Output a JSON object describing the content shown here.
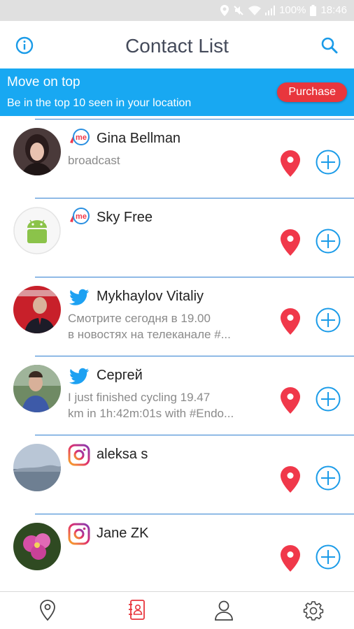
{
  "status_bar": {
    "battery": "100%",
    "time": "18:46"
  },
  "header": {
    "title": "Contact List"
  },
  "promo": {
    "title": "Move on top",
    "subtitle": "Be in the top 10 seen in your location",
    "button_label": "Purchase"
  },
  "contacts": [
    {
      "name": "Gina Bellman",
      "status": "broadcast",
      "source": "me-icon"
    },
    {
      "name": "Sky Free",
      "status": "",
      "source": "me-icon"
    },
    {
      "name": "Mykhaylov Vitaliy",
      "status": "Смотрите сегодня в 19.00\nв новостях на телеканале #...",
      "source": "twitter-icon"
    },
    {
      "name": "Сергей",
      "status": "I just finished cycling 19.47\nkm in 1h:42m:01s with #Endo...",
      "source": "twitter-icon"
    },
    {
      "name": "aleksa s",
      "status": "",
      "source": "instagram-icon"
    },
    {
      "name": "Jane ZK",
      "status": "",
      "source": "instagram-icon"
    }
  ],
  "colors": {
    "accent": "#18a8f2",
    "purchase": "#e8363d",
    "divider": "#2f7fd0",
    "pin": "#f0384a",
    "active_nav": "#e8363d"
  },
  "bottom_nav": [
    "map-pin-icon",
    "contacts-book-icon",
    "profile-icon",
    "settings-icon"
  ]
}
